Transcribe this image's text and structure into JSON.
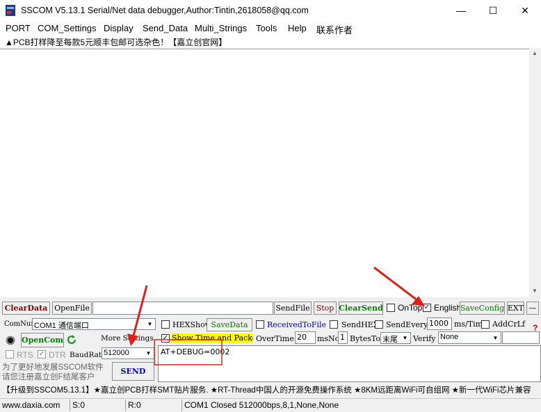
{
  "window": {
    "title": "SSCOM V5.13.1 Serial/Net data debugger,Author:Tintin,2618058@qq.com",
    "minimize": "—",
    "maximize": "☐",
    "close": "✕"
  },
  "menu": [
    "PORT",
    "COM_Settings",
    "Display",
    "Send_Data",
    "Multi_Strings",
    "Tools",
    "Help",
    "联系作者"
  ],
  "ad_line": "▲PCB打样降至每款5元顺丰包邮可选杂色！【嘉立创官网】",
  "toolbar": {
    "clear_data": "ClearData",
    "open_file": "OpenFile",
    "file_path": "",
    "send_file": "SendFile",
    "stop": "Stop",
    "clear_send": "ClearSend",
    "on_top": "OnTop",
    "english": "English",
    "save_config": "SaveConfig",
    "ext": "EXT",
    "dash": "—"
  },
  "row1": {
    "comnum_label": "ComNum",
    "comnum_value": "COM1 通信端口",
    "hexshow": "HEXShow",
    "save_data": "SaveData",
    "received_to_file": "ReceivedToFile",
    "sendhex": "SendHEX",
    "send_every": "SendEvery:",
    "interval": "1000",
    "ms_tim": "ms/Tim",
    "add_crlf": "AddCrLf",
    "question": "?"
  },
  "row2": {
    "open_com": "OpenCom",
    "more_settings": "More Settings",
    "show_time": "Show Time and Packe",
    "overtime_label": "OverTime:",
    "overtime_value": "20",
    "ms": "ms",
    "no_label": "No",
    "no_value": "1",
    "bytes_to": "BytesTo",
    "bytes_to_value": "末尾",
    "verify_label": "Verify",
    "verify_value": "None"
  },
  "row3": {
    "rts": "RTS",
    "dtr": "DTR",
    "baud_label": "BaudRat",
    "baud_value": "512000",
    "send": "SEND",
    "send_text": "AT+DEBUG=0002"
  },
  "promo": "为了更好地发展SSCOM软件\n请您注册嘉立创F结尾客户",
  "ticker": "【升级到SSCOM5.13.1】★嘉立创PCB打样SMT贴片服务. ★RT-Thread中国人的开源免费操作系统 ★8KM远距离WiFi可自组网 ★新一代WiFi芯片兼容",
  "status": {
    "site": "www.daxia.com",
    "s": "S:0",
    "r": "R:0",
    "port_status": "COM1 Closed  512000bps,8,1,None,None"
  },
  "colors": {
    "accent_red": "#8b0000",
    "accent_green": "#008000",
    "accent_blue": "#0000cc",
    "annotation_red": "#e0201a",
    "highlight_yellow": "#ffff00"
  }
}
